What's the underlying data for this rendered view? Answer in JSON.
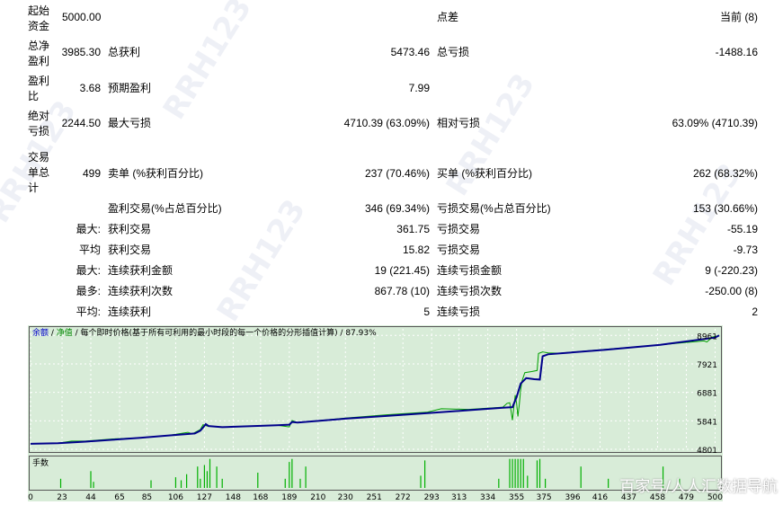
{
  "report": {
    "start_capital_label": "起始资金",
    "start_capital_value": "5000.00",
    "spread_label": "点差",
    "spread_value": "当前 (8)",
    "net_profit_label": "总净盈利",
    "net_profit_value": "3985.30",
    "gross_profit_label": "总获利",
    "gross_profit_value": "5473.46",
    "gross_loss_label": "总亏损",
    "gross_loss_value": "-1488.16",
    "profit_factor_label": "盈利比",
    "profit_factor_value": "3.68",
    "expected_payoff_label": "预期盈利",
    "expected_payoff_value": "7.99",
    "abs_drawdown_label": "绝对亏损",
    "abs_drawdown_value": "2244.50",
    "max_drawdown_label": "最大亏损",
    "max_drawdown_value": "4710.39 (63.09%)",
    "rel_drawdown_label": "相对亏损",
    "rel_drawdown_value": "63.09% (4710.39)",
    "total_trades_label": "交易单总计",
    "total_trades_value": "499",
    "short_label": "卖单 (%获利百分比)",
    "short_value": "237 (70.46%)",
    "long_label": "买单 (%获利百分比)",
    "long_value": "262 (68.32%)",
    "profit_trades_label": "盈利交易(%占总百分比)",
    "profit_trades_value": "346 (69.34%)",
    "loss_trades_label": "亏损交易(%占总百分比)",
    "loss_trades_value": "153 (30.66%)",
    "max_prefix": "最大:",
    "avg_prefix": "平均",
    "most_prefix": "最多:",
    "avg2_prefix": "平均:",
    "largest_profit_label": "获利交易",
    "largest_profit_value": "361.75",
    "largest_loss_label": "亏损交易",
    "largest_loss_value": "-55.19",
    "avg_profit_label": "获利交易",
    "avg_profit_value": "15.82",
    "avg_loss_label": "亏损交易",
    "avg_loss_value": "-9.73",
    "max_consec_win_amt_label": "连续获利金额",
    "max_consec_win_amt_value": "19 (221.45)",
    "max_consec_loss_amt_label": "连续亏损金额",
    "max_consec_loss_amt_value": "9 (-220.23)",
    "max_consec_win_cnt_label": "连续获利次数",
    "max_consec_win_cnt_value": "867.78 (10)",
    "max_consec_loss_cnt_label": "连续亏损次数",
    "max_consec_loss_cnt_value": "-250.00 (8)",
    "avg_consec_win_label": "连续获利",
    "avg_consec_win_value": "5",
    "avg_consec_loss_label": "连续亏损",
    "avg_consec_loss_value": "2"
  },
  "watermark_text": "RRH123",
  "overlay_text": "百家号/人人汇数据导航",
  "chart_data": {
    "type": "line",
    "legend": {
      "balance": "余额",
      "sep": " / ",
      "equity": "净值",
      "desc": " / 每个即时价格(基于所有可利用的最小时段的每一个价格的分形插值计算) / 87.93%"
    },
    "volume_label": "手数",
    "colors": {
      "balance": "#00008b",
      "equity": "#00a000",
      "volume": "#00b000",
      "bg": "#d8ecd8"
    },
    "ylim": [
      4801,
      9200
    ],
    "yticks": [
      4801,
      5841,
      6881,
      7921,
      8961
    ],
    "xticks": [
      0,
      23,
      44,
      65,
      85,
      106,
      127,
      148,
      168,
      189,
      210,
      230,
      251,
      272,
      293,
      313,
      334,
      355,
      375,
      396,
      416,
      437,
      458,
      479,
      500
    ],
    "xlim": [
      0,
      503
    ],
    "balance": [
      [
        0,
        5000
      ],
      [
        20,
        5020
      ],
      [
        40,
        5080
      ],
      [
        60,
        5150
      ],
      [
        80,
        5220
      ],
      [
        100,
        5300
      ],
      [
        120,
        5380
      ],
      [
        124,
        5480
      ],
      [
        126,
        5600
      ],
      [
        128,
        5720
      ],
      [
        130,
        5650
      ],
      [
        140,
        5610
      ],
      [
        180,
        5680
      ],
      [
        189,
        5700
      ],
      [
        191,
        5800
      ],
      [
        195,
        5780
      ],
      [
        230,
        5920
      ],
      [
        260,
        6020
      ],
      [
        290,
        6120
      ],
      [
        320,
        6230
      ],
      [
        345,
        6320
      ],
      [
        352,
        6340
      ],
      [
        355,
        6700
      ],
      [
        358,
        7200
      ],
      [
        362,
        7400
      ],
      [
        368,
        7360
      ],
      [
        372,
        7350
      ],
      [
        374,
        8200
      ],
      [
        378,
        8270
      ],
      [
        420,
        8440
      ],
      [
        460,
        8620
      ],
      [
        500,
        8880
      ],
      [
        503,
        8960
      ]
    ],
    "equity": [
      [
        0,
        5000
      ],
      [
        20,
        5020
      ],
      [
        30,
        5100
      ],
      [
        40,
        5100
      ],
      [
        60,
        5180
      ],
      [
        80,
        5220
      ],
      [
        100,
        5300
      ],
      [
        115,
        5420
      ],
      [
        118,
        5360
      ],
      [
        124,
        5520
      ],
      [
        126,
        5700
      ],
      [
        129,
        5650
      ],
      [
        140,
        5610
      ],
      [
        180,
        5680
      ],
      [
        189,
        5620
      ],
      [
        191,
        5850
      ],
      [
        195,
        5780
      ],
      [
        230,
        5940
      ],
      [
        260,
        6060
      ],
      [
        290,
        6160
      ],
      [
        300,
        6280
      ],
      [
        320,
        6260
      ],
      [
        345,
        6340
      ],
      [
        348,
        6480
      ],
      [
        350,
        6500
      ],
      [
        351,
        6200
      ],
      [
        352,
        5860
      ],
      [
        353,
        6350
      ],
      [
        354,
        6780
      ],
      [
        355,
        6500
      ],
      [
        356,
        6000
      ],
      [
        357,
        6450
      ],
      [
        358,
        6980
      ],
      [
        359,
        7300
      ],
      [
        361,
        7600
      ],
      [
        366,
        7640
      ],
      [
        370,
        7680
      ],
      [
        371,
        8300
      ],
      [
        374,
        8360
      ],
      [
        378,
        8320
      ],
      [
        386,
        8310
      ],
      [
        420,
        8450
      ],
      [
        460,
        8620
      ],
      [
        492,
        8760
      ],
      [
        494,
        8720
      ],
      [
        498,
        8900
      ],
      [
        503,
        8960
      ]
    ],
    "volumes": [
      [
        22,
        0.3
      ],
      [
        44,
        0.55
      ],
      [
        46,
        0.2
      ],
      [
        88,
        0.25
      ],
      [
        106,
        0.35
      ],
      [
        110,
        0.25
      ],
      [
        114,
        0.45
      ],
      [
        122,
        0.7
      ],
      [
        124,
        0.3
      ],
      [
        127,
        0.75
      ],
      [
        129,
        0.55
      ],
      [
        131,
        0.95
      ],
      [
        136,
        0.7
      ],
      [
        140,
        0.3
      ],
      [
        166,
        0.5
      ],
      [
        186,
        0.3
      ],
      [
        189,
        0.85
      ],
      [
        191,
        0.95
      ],
      [
        197,
        0.3
      ],
      [
        201,
        0.7
      ],
      [
        285,
        0.4
      ],
      [
        288,
        0.9
      ],
      [
        342,
        0.3
      ],
      [
        350,
        0.95
      ],
      [
        352,
        0.95
      ],
      [
        354,
        0.95
      ],
      [
        356,
        0.95
      ],
      [
        358,
        0.95
      ],
      [
        360,
        0.95
      ],
      [
        363,
        0.4
      ],
      [
        370,
        0.9
      ],
      [
        372,
        0.95
      ],
      [
        376,
        0.3
      ],
      [
        402,
        0.7
      ],
      [
        422,
        0.3
      ],
      [
        462,
        0.7
      ],
      [
        474,
        0.3
      ]
    ]
  }
}
